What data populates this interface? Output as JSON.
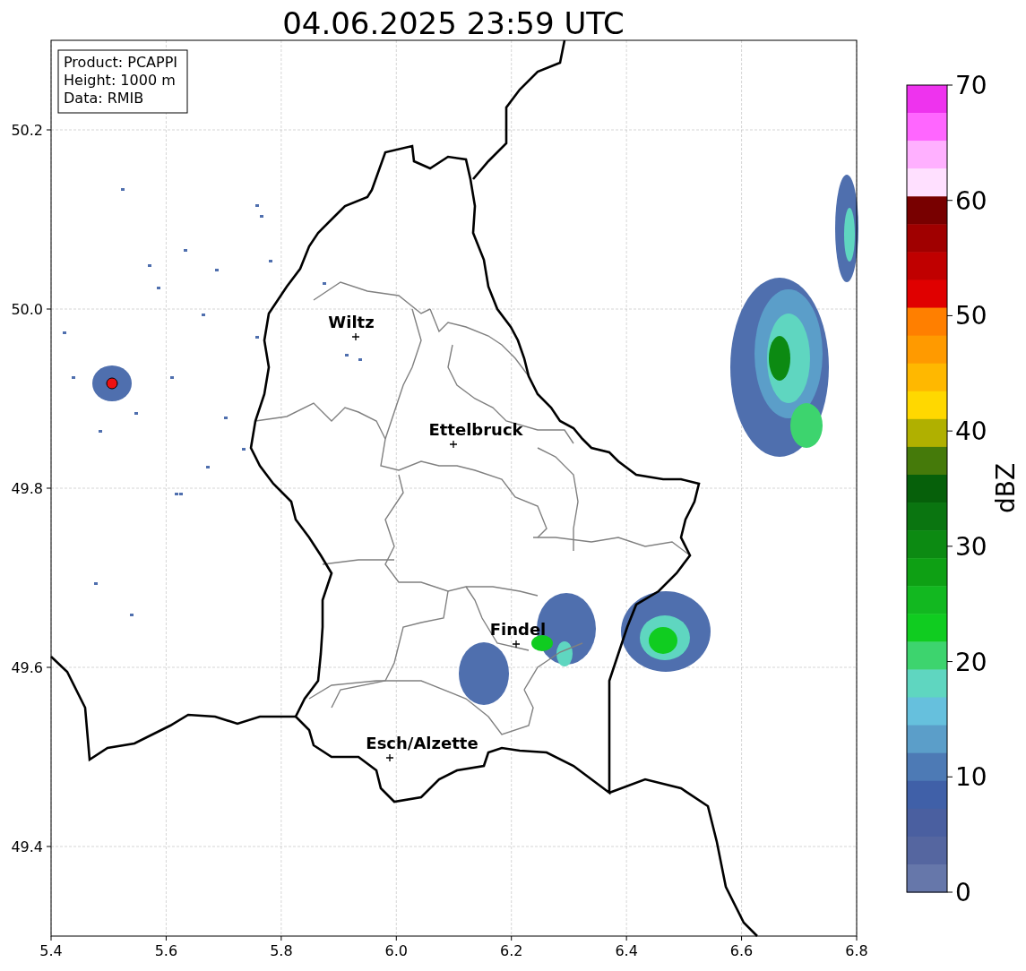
{
  "title": "04.06.2025 23:59 UTC",
  "info_box": [
    "Product: PCAPPI",
    "Height: 1000 m",
    "Data: RMIB"
  ],
  "map": {
    "x_ticks": [
      "5.4",
      "5.6",
      "5.8",
      "6.0",
      "6.2",
      "6.4",
      "6.6",
      "6.8"
    ],
    "y_ticks": [
      "50.2",
      "50.0",
      "49.8",
      "49.6",
      "49.4"
    ],
    "cities": [
      {
        "name": "Wiltz"
      },
      {
        "name": "Ettelbruck"
      },
      {
        "name": "Findel"
      },
      {
        "name": "Esch/Alzette"
      }
    ]
  },
  "colorbar": {
    "label": "dBZ",
    "ticks": [
      "70",
      "60",
      "50",
      "40",
      "30",
      "20",
      "10",
      "0"
    ],
    "bands": [
      {
        "color": "#ee33ee"
      },
      {
        "color": "#ff66ff"
      },
      {
        "color": "#ffb0ff"
      },
      {
        "color": "#ffe0ff"
      },
      {
        "color": "#780000"
      },
      {
        "color": "#a00000"
      },
      {
        "color": "#c00000"
      },
      {
        "color": "#e00000"
      },
      {
        "color": "#ff7f00"
      },
      {
        "color": "#ff9a00"
      },
      {
        "color": "#ffb800"
      },
      {
        "color": "#ffd800"
      },
      {
        "color": "#b0b000"
      },
      {
        "color": "#457a0a"
      },
      {
        "color": "#06600a"
      },
      {
        "color": "#0a7510"
      },
      {
        "color": "#0c8a12"
      },
      {
        "color": "#0ea014"
      },
      {
        "color": "#12b820"
      },
      {
        "color": "#10cc20"
      },
      {
        "color": "#3dd46e"
      },
      {
        "color": "#5fd6c0"
      },
      {
        "color": "#66c0dd"
      },
      {
        "color": "#5b9ec9"
      },
      {
        "color": "#4d7ab5"
      },
      {
        "color": "#4060a8"
      },
      {
        "color": "#4a5fa0"
      },
      {
        "color": "#5566a0"
      },
      {
        "color": "#6677aa"
      }
    ]
  }
}
